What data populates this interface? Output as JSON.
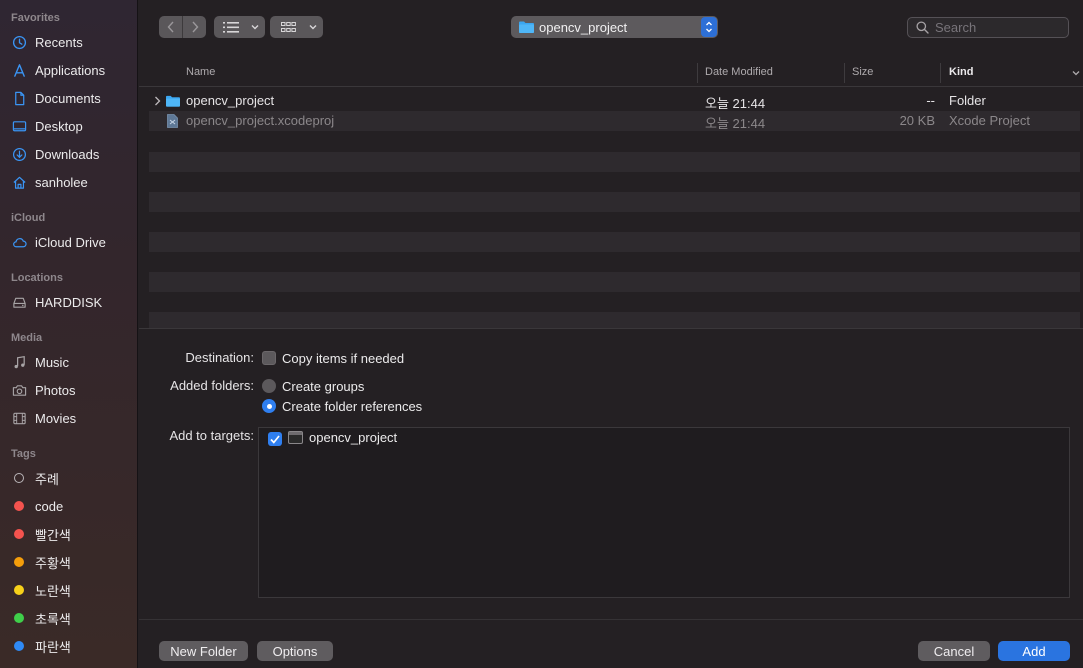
{
  "sidebar": {
    "sections": {
      "favorites": "Favorites",
      "icloud": "iCloud",
      "locations": "Locations",
      "media": "Media",
      "tags": "Tags"
    },
    "favorites": [
      {
        "label": "Recents",
        "icon": "clock-icon"
      },
      {
        "label": "Applications",
        "icon": "applications-icon"
      },
      {
        "label": "Documents",
        "icon": "document-icon"
      },
      {
        "label": "Desktop",
        "icon": "desktop-icon"
      },
      {
        "label": "Downloads",
        "icon": "download-icon"
      },
      {
        "label": "sanholee",
        "icon": "home-icon"
      }
    ],
    "icloud": [
      {
        "label": "iCloud Drive",
        "icon": "cloud-icon"
      }
    ],
    "locations": [
      {
        "label": "HARDDISK",
        "icon": "harddisk-icon"
      }
    ],
    "media": [
      {
        "label": "Music",
        "icon": "music-icon"
      },
      {
        "label": "Photos",
        "icon": "camera-icon"
      },
      {
        "label": "Movies",
        "icon": "film-icon"
      }
    ],
    "tags": [
      {
        "label": "주례",
        "color": ""
      },
      {
        "label": "code",
        "color": "#f4534e"
      },
      {
        "label": "빨간색",
        "color": "#f4534e"
      },
      {
        "label": "주황색",
        "color": "#f59e0b"
      },
      {
        "label": "노란색",
        "color": "#f7d11a"
      },
      {
        "label": "초록색",
        "color": "#3fcf4a"
      },
      {
        "label": "파란색",
        "color": "#2f8af5"
      }
    ]
  },
  "toolbar": {
    "path_label": "opencv_project",
    "search_placeholder": "Search"
  },
  "columns": {
    "name": "Name",
    "date": "Date Modified",
    "size": "Size",
    "kind": "Kind"
  },
  "files": [
    {
      "name": "opencv_project",
      "date": "오늘 21:44",
      "size": "--",
      "kind": "Folder"
    },
    {
      "name": "opencv_project.xcodeproj",
      "date": "오늘 21:44",
      "size": "20 KB",
      "kind": "Xcode Project"
    }
  ],
  "options": {
    "destination_label": "Destination:",
    "copy_items": "Copy items if needed",
    "added_folders_label": "Added folders:",
    "create_groups": "Create groups",
    "create_folder_refs": "Create folder references",
    "add_to_targets_label": "Add to targets:",
    "target_name": "opencv_project"
  },
  "buttons": {
    "new_folder": "New Folder",
    "options": "Options",
    "cancel": "Cancel",
    "add": "Add"
  },
  "colors": {
    "accent": "#2a74e0",
    "folder": "#3ba6f0"
  }
}
